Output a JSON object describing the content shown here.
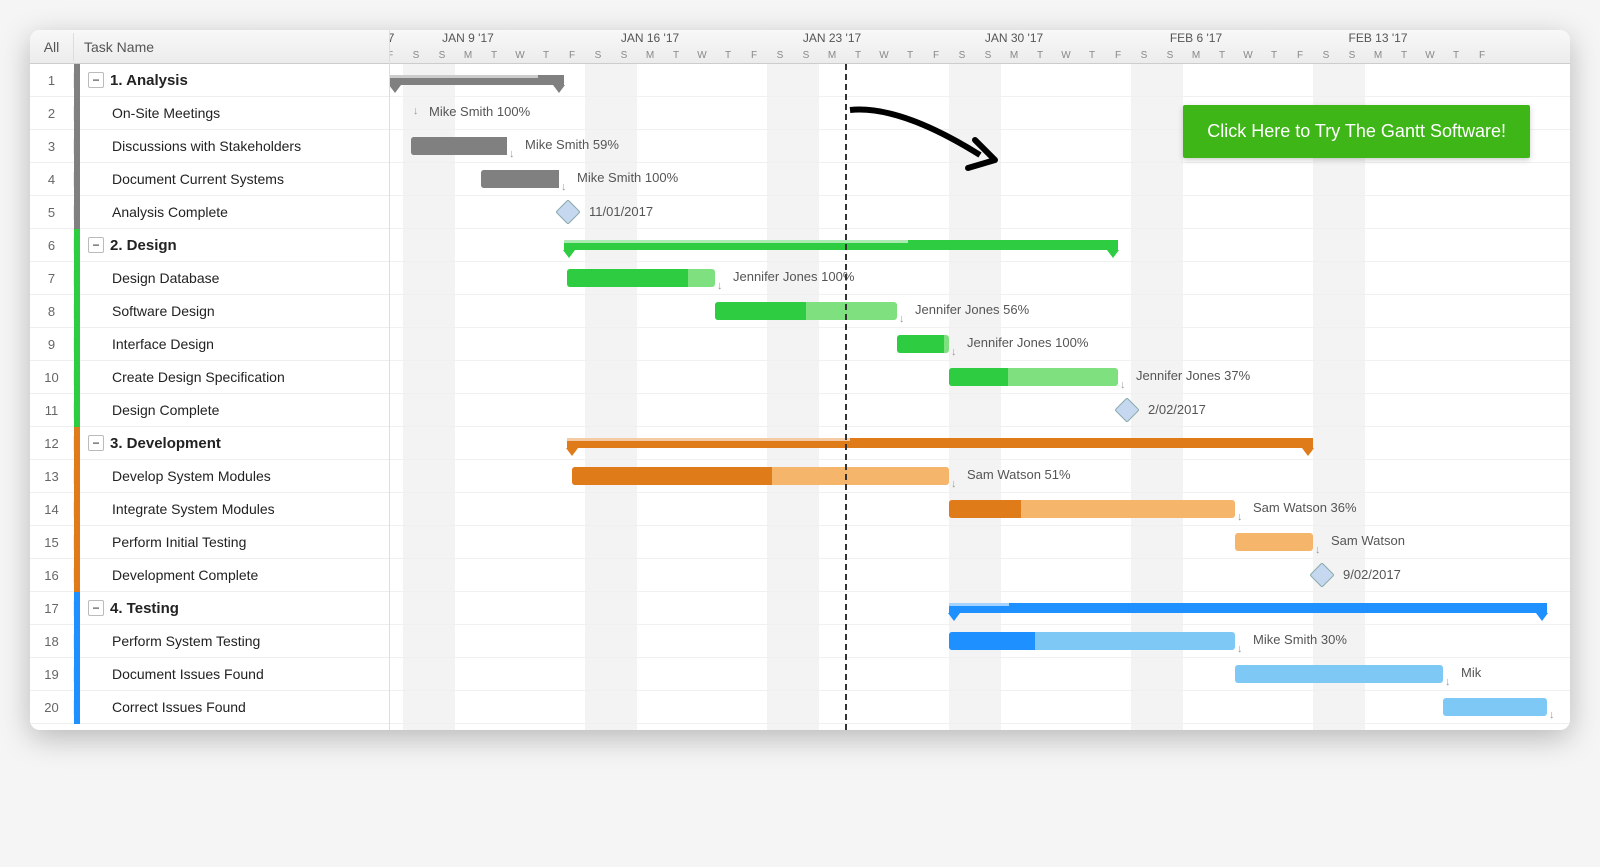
{
  "header": {
    "all": "All",
    "task_name": "Task Name"
  },
  "timeline": {
    "day_width": 26,
    "start_offset": -0.5,
    "weeks": [
      {
        "label": "'7",
        "day": 0,
        "partial": true
      },
      {
        "label": "JAN 9 '17",
        "day": 3
      },
      {
        "label": "JAN 16 '17",
        "day": 10
      },
      {
        "label": "JAN 23 '17",
        "day": 17
      },
      {
        "label": "JAN 30 '17",
        "day": 24
      },
      {
        "label": "FEB 6 '17",
        "day": 31
      },
      {
        "label": "FEB 13 '17",
        "day": 38
      }
    ],
    "day_letters": [
      "F",
      "S",
      "S",
      "M",
      "T",
      "W",
      "T",
      "F",
      "S",
      "S",
      "M",
      "T",
      "W",
      "T",
      "F",
      "S",
      "S",
      "M",
      "T",
      "W",
      "T",
      "F",
      "S",
      "S",
      "M",
      "T",
      "W",
      "T",
      "F",
      "S",
      "S",
      "M",
      "T",
      "W",
      "T",
      "F",
      "S",
      "S",
      "M",
      "T",
      "W",
      "T",
      "F"
    ],
    "today_day": 17.5,
    "weekend_pairs": [
      1,
      2,
      8,
      9,
      15,
      16,
      22,
      23,
      29,
      30,
      36,
      37
    ]
  },
  "cta": {
    "label": "Click Here to Try The Gantt Software!"
  },
  "colors": {
    "analysis": "#808080",
    "design": "#2ecc40",
    "development": "#e07b1a",
    "testing": "#1e90ff",
    "design_light": "#7ee07e",
    "dev_light": "#f5b56b",
    "test_light": "#7ec8f5"
  },
  "rows": [
    {
      "n": 1,
      "type": "group",
      "name": "1. Analysis",
      "color": "analysis",
      "bar": {
        "start": -0.5,
        "end": 6.2,
        "summary": true,
        "progress": 0.85
      }
    },
    {
      "n": 2,
      "type": "task",
      "name": "On-Site Meetings",
      "indent": 1,
      "bar": null,
      "label": "Mike Smith  100%",
      "label_day": 1
    },
    {
      "n": 3,
      "type": "task",
      "name": "Discussions with Stakeholders",
      "indent": 1,
      "bar": {
        "start": 0.3,
        "end": 4,
        "color": "analysis",
        "progress": 1
      },
      "label": "Mike Smith  59%"
    },
    {
      "n": 4,
      "type": "task",
      "name": "Document Current Systems",
      "indent": 1,
      "bar": {
        "start": 3,
        "end": 6,
        "color": "analysis",
        "progress": 1
      },
      "label": "Mike Smith  100%"
    },
    {
      "n": 5,
      "type": "task",
      "name": "Analysis Complete",
      "indent": 1,
      "milestone": {
        "day": 6,
        "label": "11/01/2017"
      }
    },
    {
      "n": 6,
      "type": "group",
      "name": "2. Design",
      "color": "design",
      "bar": {
        "start": 6.2,
        "end": 27.5,
        "summary": true,
        "progress": 0.62,
        "color": "design"
      }
    },
    {
      "n": 7,
      "type": "task",
      "name": "Design Database",
      "indent": 1,
      "bar": {
        "start": 6.3,
        "end": 12,
        "color": "design",
        "light": "design_light",
        "progress": 0.82
      },
      "label": "Jennifer Jones  100%"
    },
    {
      "n": 8,
      "type": "task",
      "name": "Software Design",
      "indent": 1,
      "bar": {
        "start": 12,
        "end": 19,
        "color": "design",
        "light": "design_light",
        "progress": 0.5
      },
      "label": "Jennifer Jones  56%"
    },
    {
      "n": 9,
      "type": "task",
      "name": "Interface Design",
      "indent": 1,
      "bar": {
        "start": 19,
        "end": 21,
        "color": "design",
        "light": "design_light",
        "progress": 0.9
      },
      "label": "Jennifer Jones  100%"
    },
    {
      "n": 10,
      "type": "task",
      "name": "Create Design Specification",
      "indent": 1,
      "bar": {
        "start": 21,
        "end": 27.5,
        "color": "design",
        "light": "design_light",
        "progress": 0.35
      },
      "label": "Jennifer Jones  37%"
    },
    {
      "n": 11,
      "type": "task",
      "name": "Design Complete",
      "indent": 1,
      "milestone": {
        "day": 27.5,
        "label": "2/02/2017"
      }
    },
    {
      "n": 12,
      "type": "group",
      "name": "3. Development",
      "color": "development",
      "bar": {
        "start": 6.3,
        "end": 35,
        "summary": true,
        "progress": 0.38,
        "color": "development"
      }
    },
    {
      "n": 13,
      "type": "task",
      "name": "Develop System Modules",
      "indent": 1,
      "bar": {
        "start": 6.5,
        "end": 21,
        "color": "development",
        "light": "dev_light",
        "progress": 0.53
      },
      "label": "Sam Watson  51%"
    },
    {
      "n": 14,
      "type": "task",
      "name": "Integrate System Modules",
      "indent": 1,
      "bar": {
        "start": 21,
        "end": 32,
        "color": "development",
        "light": "dev_light",
        "progress": 0.25
      },
      "label": "Sam Watson  36%"
    },
    {
      "n": 15,
      "type": "task",
      "name": "Perform Initial Testing",
      "indent": 1,
      "bar": {
        "start": 32,
        "end": 35,
        "color": "development",
        "light": "dev_light",
        "progress": 0
      },
      "label": "Sam Watson"
    },
    {
      "n": 16,
      "type": "task",
      "name": "Development Complete",
      "indent": 1,
      "milestone": {
        "day": 35,
        "label": "9/02/2017"
      }
    },
    {
      "n": 17,
      "type": "group",
      "name": "4. Testing",
      "color": "testing",
      "bar": {
        "start": 21,
        "end": 44,
        "summary": true,
        "progress": 0.1,
        "color": "testing"
      }
    },
    {
      "n": 18,
      "type": "task",
      "name": "Perform System Testing",
      "indent": 1,
      "bar": {
        "start": 21,
        "end": 32,
        "color": "testing",
        "light": "test_light",
        "progress": 0.3
      },
      "label": "Mike Smith  30%"
    },
    {
      "n": 19,
      "type": "task",
      "name": "Document Issues Found",
      "indent": 1,
      "bar": {
        "start": 32,
        "end": 40,
        "color": "testing",
        "light": "test_light",
        "progress": 0
      },
      "label": "Mik"
    },
    {
      "n": 20,
      "type": "task",
      "name": "Correct Issues Found",
      "indent": 1,
      "bar": {
        "start": 40,
        "end": 44,
        "color": "testing",
        "light": "test_light",
        "progress": 0
      }
    }
  ]
}
